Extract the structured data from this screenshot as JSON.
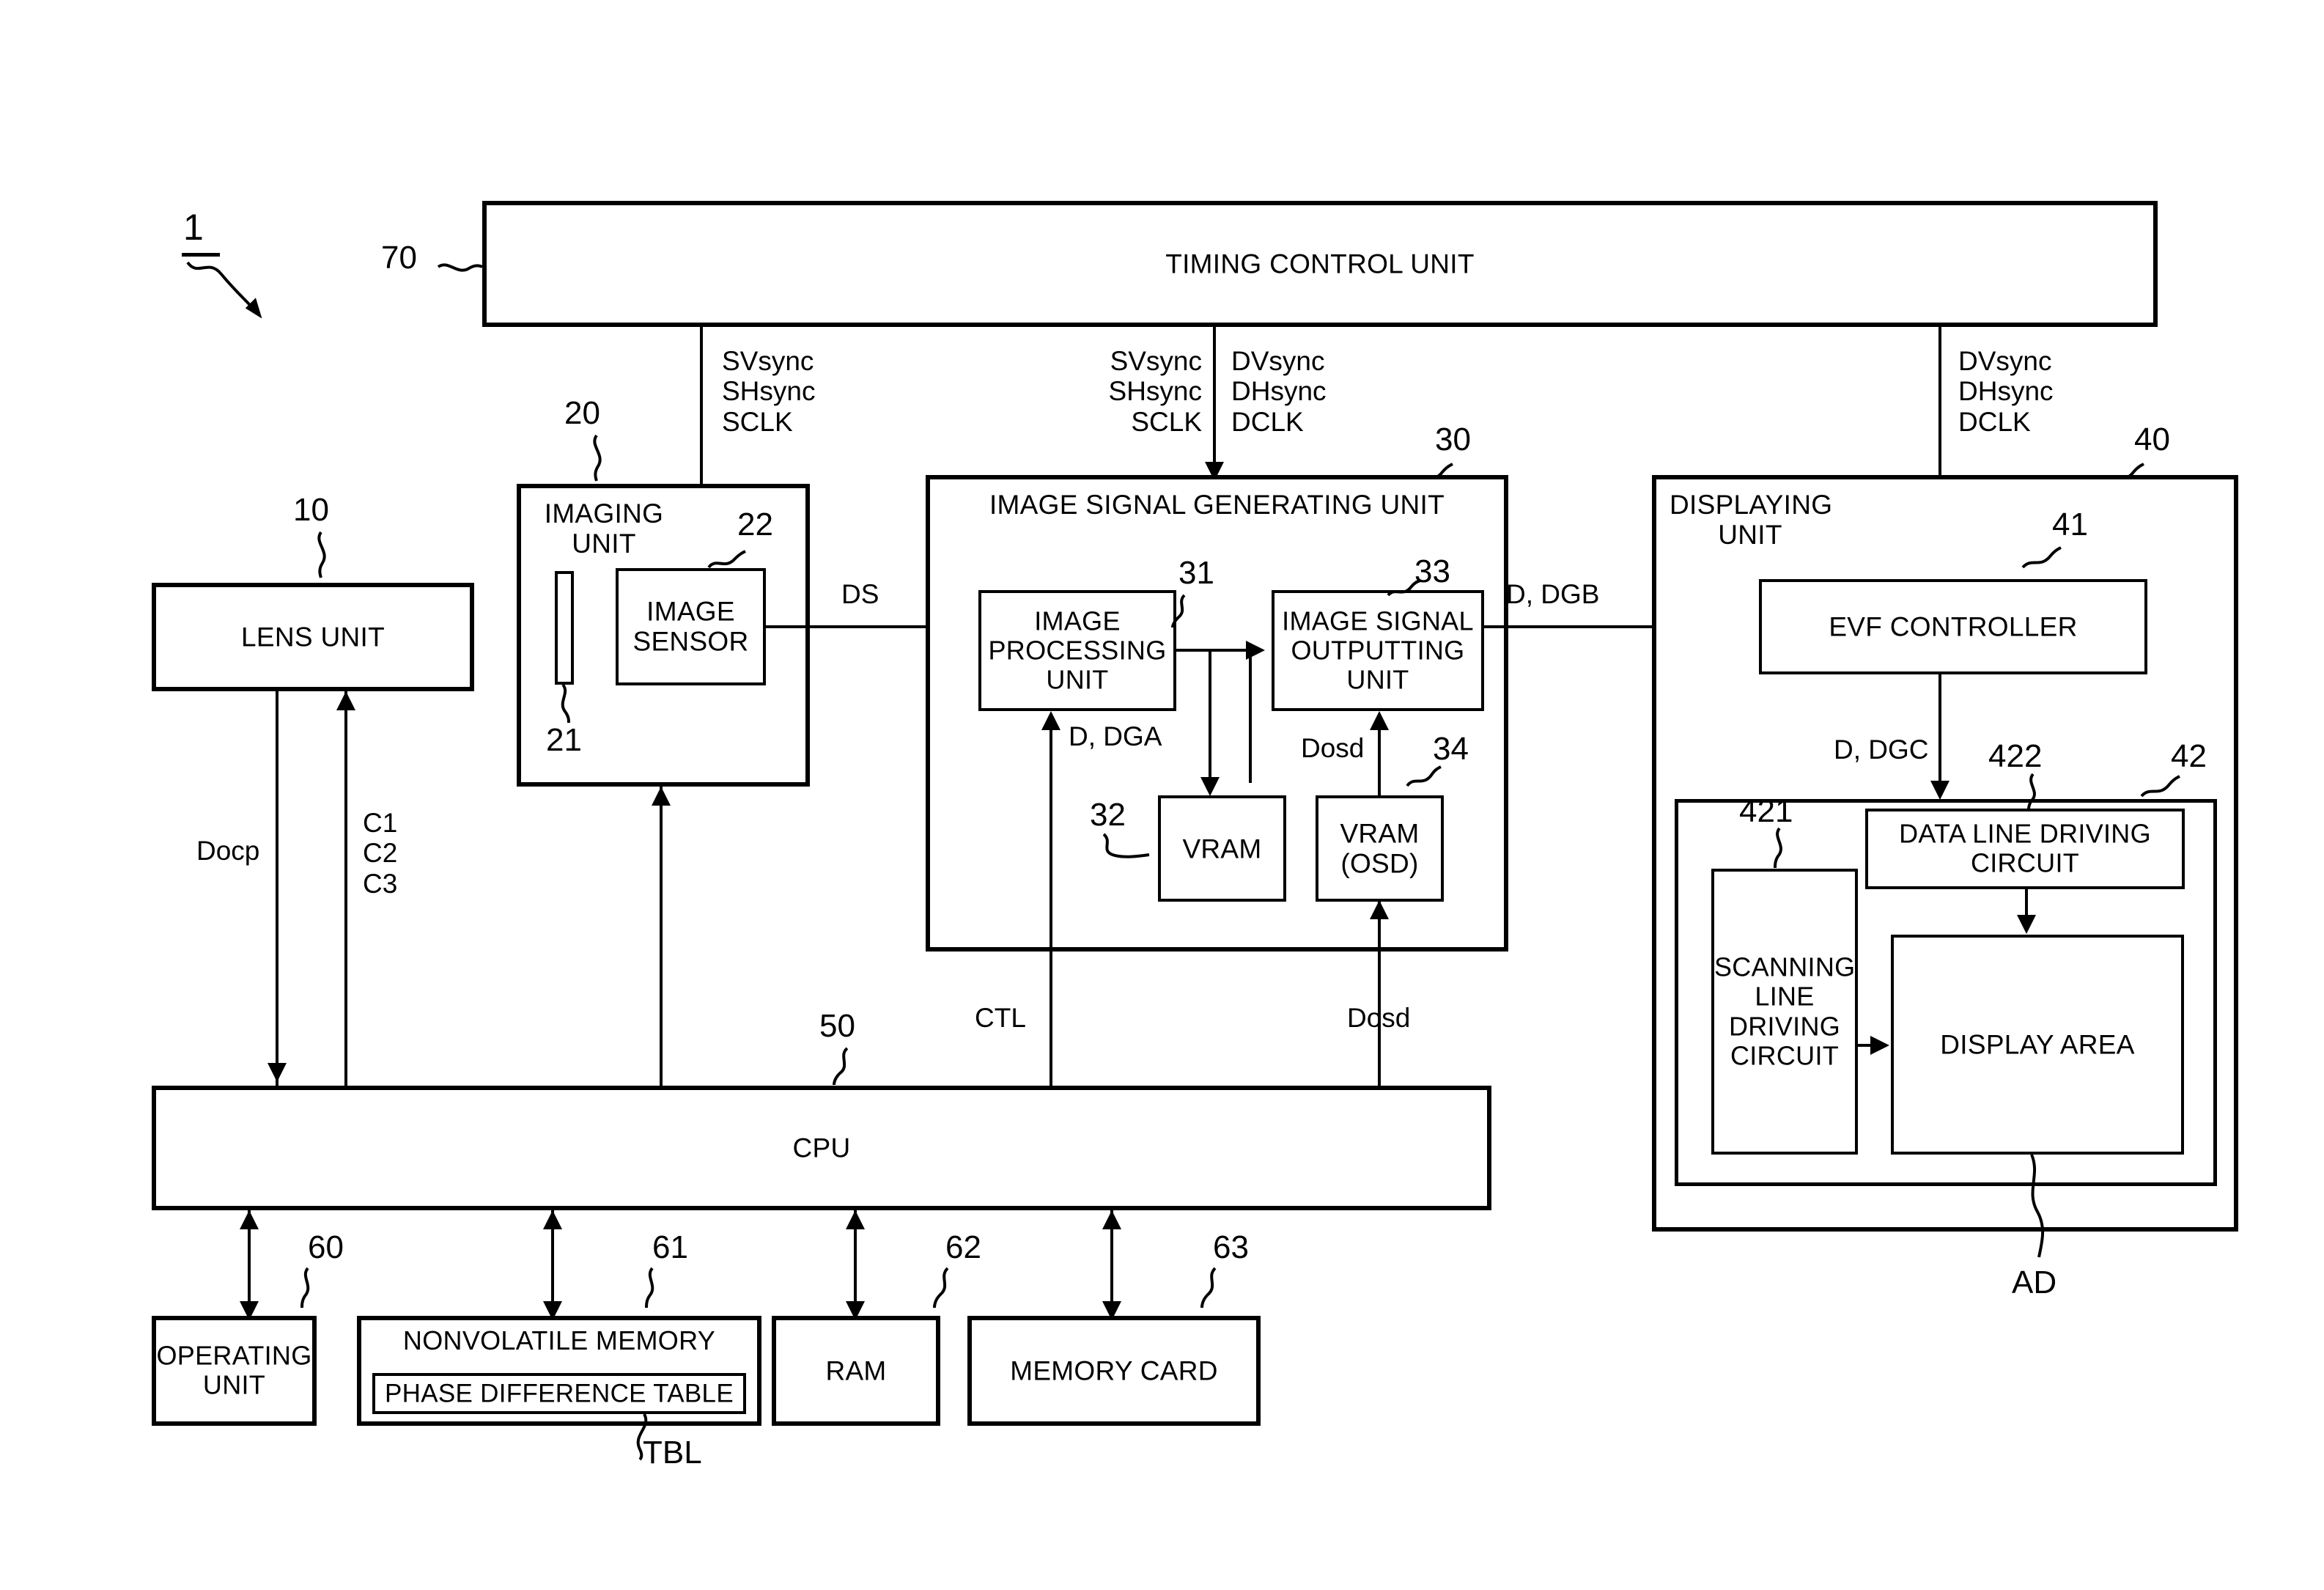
{
  "figure": {
    "assembly_ref": "1",
    "blocks": {
      "timing_control_unit": {
        "ref": "70",
        "label": "TIMING CONTROL UNIT"
      },
      "lens_unit": {
        "ref": "10",
        "label": "LENS UNIT"
      },
      "imaging_unit": {
        "ref": "20",
        "label": "IMAGING\nUNIT"
      },
      "shutter": {
        "ref": "21",
        "label": ""
      },
      "image_sensor": {
        "ref": "22",
        "label": "IMAGE\nSENSOR"
      },
      "image_signal_generating_unit": {
        "ref": "30",
        "label": "IMAGE SIGNAL GENERATING UNIT"
      },
      "image_processing_unit": {
        "ref": "31",
        "label": "IMAGE\nPROCESSING\nUNIT"
      },
      "vram": {
        "ref": "32",
        "label": "VRAM"
      },
      "image_signal_outputting_unit": {
        "ref": "33",
        "label": "IMAGE SIGNAL\nOUTPUTTING\nUNIT"
      },
      "vram_osd": {
        "ref": "34",
        "label": "VRAM\n(OSD)"
      },
      "displaying_unit": {
        "ref": "40",
        "label": "DISPLAYING\nUNIT"
      },
      "evf_controller": {
        "ref": "41",
        "label": "EVF CONTROLLER"
      },
      "display_panel": {
        "ref": "42",
        "label": ""
      },
      "scanning_line_driving_circuit": {
        "ref": "421",
        "label": "SCANNING\nLINE\nDRIVING\nCIRCUIT"
      },
      "data_line_driving_circuit": {
        "ref": "422",
        "label": "DATA LINE\nDRIVING CIRCUIT"
      },
      "display_area": {
        "ref": "AD",
        "label": "DISPLAY AREA"
      },
      "cpu": {
        "ref": "50",
        "label": "CPU"
      },
      "operating_unit": {
        "ref": "60",
        "label": "OPERATING\nUNIT"
      },
      "nonvolatile_memory": {
        "ref": "61",
        "label": "NONVOLATILE MEMORY"
      },
      "phase_difference_table": {
        "ref": "TBL",
        "label": "PHASE DIFFERENCE TABLE"
      },
      "ram": {
        "ref": "62",
        "label": "RAM"
      },
      "memory_card": {
        "ref": "63",
        "label": "MEMORY CARD"
      }
    },
    "signals": {
      "sensor_timing": "SVsync\nSHsync\nSCLK",
      "sensor_timing_2": "SVsync\nSHsync\nSCLK",
      "display_timing": "DVsync\nDHsync\nDCLK",
      "display_timing_2": "DVsync\nDHsync\nDCLK",
      "ds": "DS",
      "d_dga": "D, DGA",
      "d_dgb": "D, DGB",
      "d_dgc": "D, DGC",
      "dosd_inner": "Dosd",
      "dosd_bus": "Dosd",
      "ctl": "CTL",
      "docp": "Docp",
      "c123": "C1\nC2\nC3",
      "ad": "AD"
    }
  }
}
